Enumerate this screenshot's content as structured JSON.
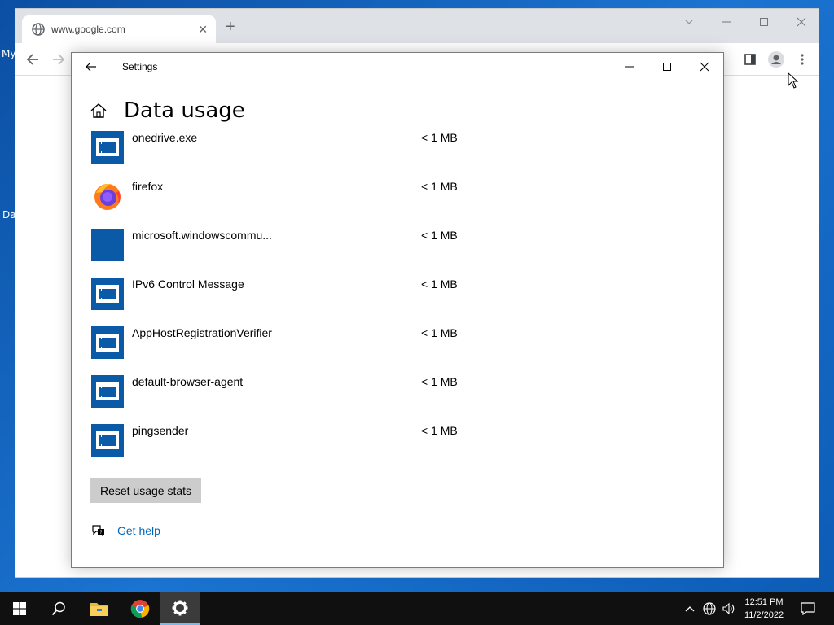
{
  "desktop": {
    "label_1": "My",
    "label_2": "Da"
  },
  "browser": {
    "tab_title": "www.google.com",
    "tab_close": "✕",
    "new_tab": "+"
  },
  "settings": {
    "window_title": "Settings",
    "page_title": "Data usage",
    "apps": [
      {
        "name": "onedrive.exe",
        "usage": "< 1 MB",
        "icon": "generic-app-icon"
      },
      {
        "name": "firefox",
        "usage": "< 1 MB",
        "icon": "firefox-icon"
      },
      {
        "name": "microsoft.windowscommu...",
        "usage": "< 1 MB",
        "icon": "blank-app-icon"
      },
      {
        "name": "IPv6 Control Message",
        "usage": "< 1 MB",
        "icon": "generic-app-icon"
      },
      {
        "name": "AppHostRegistrationVerifier",
        "usage": "< 1 MB",
        "icon": "generic-app-icon"
      },
      {
        "name": "default-browser-agent",
        "usage": "< 1 MB",
        "icon": "generic-app-icon"
      },
      {
        "name": "pingsender",
        "usage": "< 1 MB",
        "icon": "generic-app-icon"
      }
    ],
    "reset_label": "Reset usage stats",
    "help_label": "Get help"
  },
  "taskbar": {
    "time": "12:51 PM",
    "date": "11/2/2022"
  },
  "colors": {
    "app_icon_blue": "#0a5aa8",
    "link_blue": "#0067b8",
    "taskbar": "#101010"
  }
}
